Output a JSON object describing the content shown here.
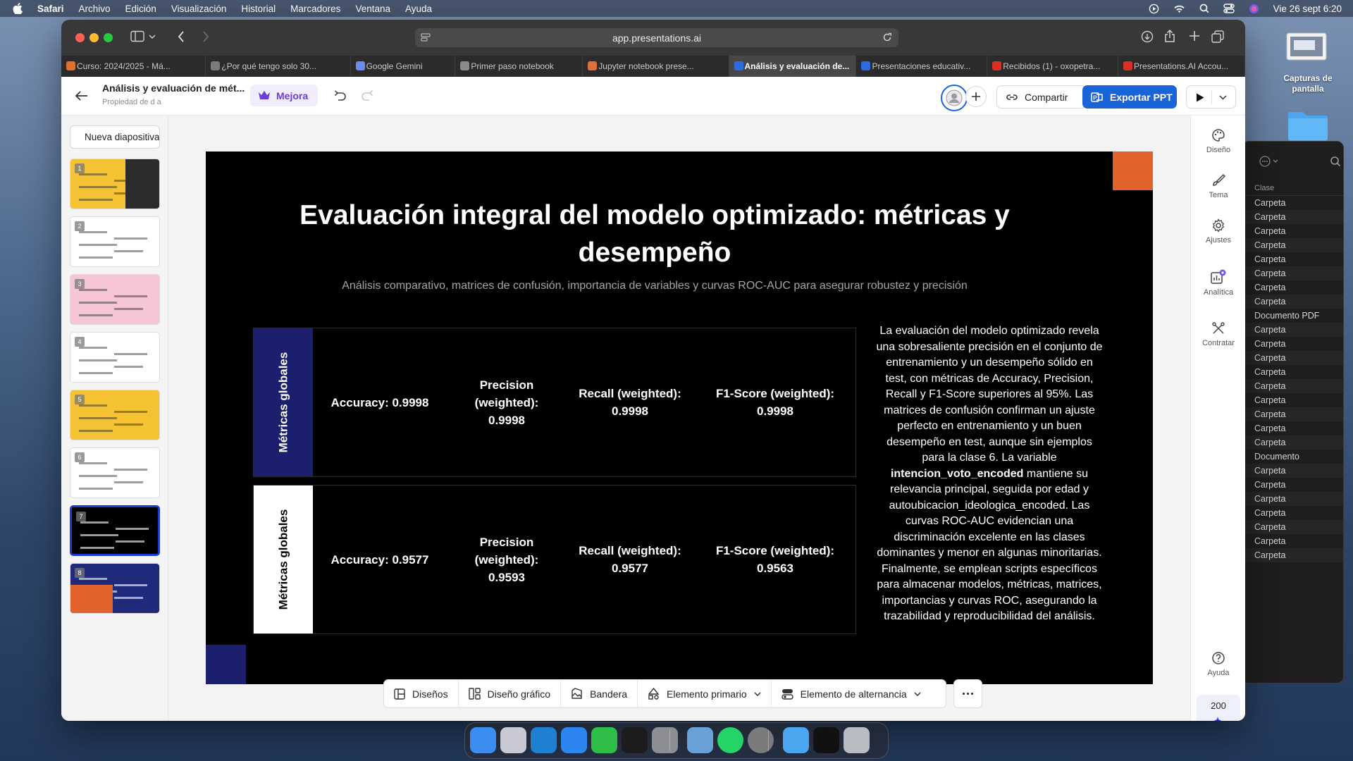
{
  "menubar": {
    "app": "Safari",
    "items": [
      "Archivo",
      "Edición",
      "Visualización",
      "Historial",
      "Marcadores",
      "Ventana",
      "Ayuda"
    ],
    "datetime": "Vie 26 sept 6:20"
  },
  "desktop": {
    "screenshots_folder": "Capturas de pantalla"
  },
  "finder": {
    "column": "Clase",
    "rows": [
      "Carpeta",
      "Carpeta",
      "Carpeta",
      "Carpeta",
      "Carpeta",
      "Carpeta",
      "Carpeta",
      "Carpeta",
      "Documento PDF",
      "Carpeta",
      "Carpeta",
      "Carpeta",
      "Carpeta",
      "Carpeta",
      "Carpeta",
      "Carpeta",
      "Carpeta",
      "Carpeta",
      "Documento",
      "Carpeta",
      "Carpeta",
      "Carpeta",
      "Carpeta",
      "Carpeta",
      "Carpeta",
      "Carpeta"
    ]
  },
  "browser": {
    "url": "app.presentations.ai",
    "tabs": [
      {
        "label": "Curso: 2024/2025 - Má...",
        "color": "#e0702e"
      },
      {
        "label": "¿Por qué tengo solo 30...",
        "color": "#7a7a7a"
      },
      {
        "label": "Google Gemini",
        "color": "#6a8cf0"
      },
      {
        "label": "Primer paso notebook",
        "color": "#8a8a8a"
      },
      {
        "label": "Jupyter notebook prese...",
        "color": "#e0703a"
      },
      {
        "label": "Análisis y evaluación de...",
        "color": "#2f6be0"
      },
      {
        "label": "Presentaciones educativ...",
        "color": "#2f6be0"
      },
      {
        "label": "Recibidos (1) - oxopetra...",
        "color": "#d93025"
      },
      {
        "label": "Presentations.AI Accou...",
        "color": "#d93025"
      }
    ],
    "active_tab": 5
  },
  "app": {
    "doc_title": "Análisis y evaluación de mét...",
    "doc_subtitle": "Propiedad de d a",
    "upgrade_label": "Mejora",
    "share_label": "Compartir",
    "export_label": "Exportar PPT",
    "new_slide_label": "Nueva diapositiva",
    "thumbnails": [
      {
        "num": "1",
        "bg": "#f4c233"
      },
      {
        "num": "2",
        "bg": "#ffffff"
      },
      {
        "num": "3",
        "bg": "#f6c6d6"
      },
      {
        "num": "4",
        "bg": "#ffffff"
      },
      {
        "num": "5",
        "bg": "#f4c233"
      },
      {
        "num": "6",
        "bg": "#ffffff"
      },
      {
        "num": "7",
        "bg": "#000000"
      },
      {
        "num": "8",
        "bg": "#1f2a7a"
      }
    ],
    "selected_thumbnail": 6,
    "toolbar": [
      "Diseños",
      "Diseño gráfico",
      "Bandera",
      "Elemento primario",
      "Elemento de alternancia"
    ],
    "rail": [
      "Diseño",
      "Tema",
      "Ajustes",
      "Analítica",
      "Contratar"
    ],
    "help_label": "Ayuda",
    "credits": "200"
  },
  "slide": {
    "title": "Evaluación integral del modelo optimizado: métricas y desempeño",
    "subtitle": "Análisis comparativo, matrices de confusión, importancia de variables y curvas ROC-AUC para asegurar robustez y precisión",
    "cards": [
      {
        "label": "Métricas globales",
        "metrics": [
          "Accuracy: 0.9998",
          "Precision (weighted): 0.9998",
          "Recall (weighted): 0.9998",
          "F1-Score (weighted): 0.9998"
        ]
      },
      {
        "label": "Métricas globales",
        "metrics": [
          "Accuracy: 0.9577",
          "Precision (weighted): 0.9593",
          "Recall (weighted): 0.9577",
          "F1-Score (weighted): 0.9563"
        ]
      }
    ],
    "paragraph_before": "La evaluación del modelo optimizado revela una sobresaliente precisión en el conjunto de entrenamiento y un desempeño sólido en test, con métricas de Accuracy, Precision, Recall y F1-Score superiores al 95%. Las matrices de confusión confirman un ajuste perfecto en entrenamiento y un buen desempeño en test, aunque sin ejemplos para la clase 6. La variable ",
    "paragraph_bold": "intencion_voto_encoded",
    "paragraph_after": " mantiene su relevancia principal, seguida por edad y autoubicacion_ideologica_encoded. Las curvas ROC-AUC evidencian una discriminación excelente en las clases dominantes y menor en algunas minoritarias. Finalmente, se emplean scripts específicos para almacenar modelos, métricas, matrices, importancias y curvas ROC, asegurando la trazabilidad y reproducibilidad del análisis.",
    "accent_color": "#e0632d",
    "navy_color": "#1b1f6e"
  },
  "dock": {
    "icons": [
      "finder-icon",
      "launchpad-icon",
      "vscode-icon",
      "safari-icon",
      "facetime-icon",
      "terminal-icon",
      "settings-icon",
      "preview-icon",
      "whatsapp-icon",
      "tex-icon",
      "downloads-icon",
      "iterm-icon",
      "trash-icon"
    ]
  }
}
